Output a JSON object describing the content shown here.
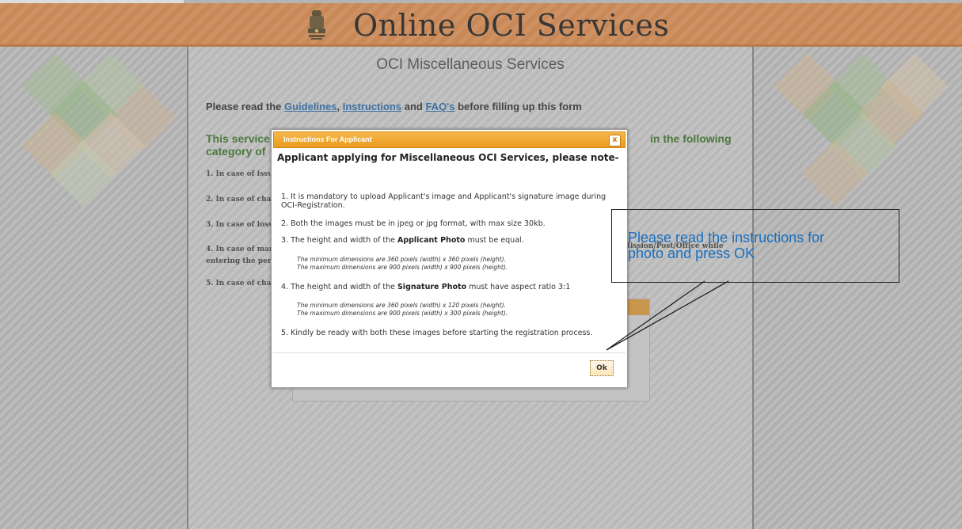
{
  "header": {
    "title": "Online OCI Services",
    "emblem_icon": "national-emblem-icon"
  },
  "main": {
    "heading": "OCI Miscellaneous Services",
    "read_prefix": "Please read the ",
    "links": [
      "Guidelines",
      "Instructions",
      "FAQ's"
    ],
    "read_sep1": ", ",
    "read_sep2": " and ",
    "read_suffix": " before filling up this form",
    "service_text_left": "This service",
    "service_text_left2": "category of",
    "service_text_right": "in the following",
    "cases": [
      "1. In case of issu",
      "2. In case of char",
      "3. In case of loss/",
      "4. In case of man",
      "entering the pers",
      "5. In case of char"
    ],
    "case4_right": "Mission/Post/Office while"
  },
  "modal": {
    "title": "Instructions For Applicant",
    "close_label": "x",
    "heading": "Applicant applying for Miscellaneous OCI Services, please note-",
    "item1": "1. It is mandatory to upload Applicant's image and Applicant's signature image during OCI-Registration.",
    "item2": "2. Both the images must be in jpeg or jpg format, with max size 30kb.",
    "item3_prefix": "3. The height and width of the ",
    "item3_bold": "Applicant Photo",
    "item3_suffix": " must be equal.",
    "item3_note1": "The minimum dimensions are 360 pixels (width) x 360 pixels (height).",
    "item3_note2": "The maximum dimensions are 900 pixels (width) x 900 pixels (height).",
    "item4_prefix": "4. The height and width of the ",
    "item4_bold": "Signature Photo",
    "item4_suffix": " must have aspect ratio 3:1",
    "item4_note1": "The minimum dimensions are 360 pixels (width) x 120 pixels (height).",
    "item4_note2": "The maximum dimensions are 900 pixels (width) x 300 pixels (height).",
    "item5": "5. Kindly be ready with both these images before starting the registration process.",
    "ok_label": "Ok"
  },
  "callout": {
    "text_line1": "Please read the instructions for",
    "text_line2": "photo and press OK"
  },
  "colors": {
    "header_orange": "#e58e4c",
    "link_blue": "#2a6fb3",
    "service_green": "#3c7a2a",
    "titlebar_orange": "#e89a1f",
    "callout_blue": "#1a6fc0"
  }
}
